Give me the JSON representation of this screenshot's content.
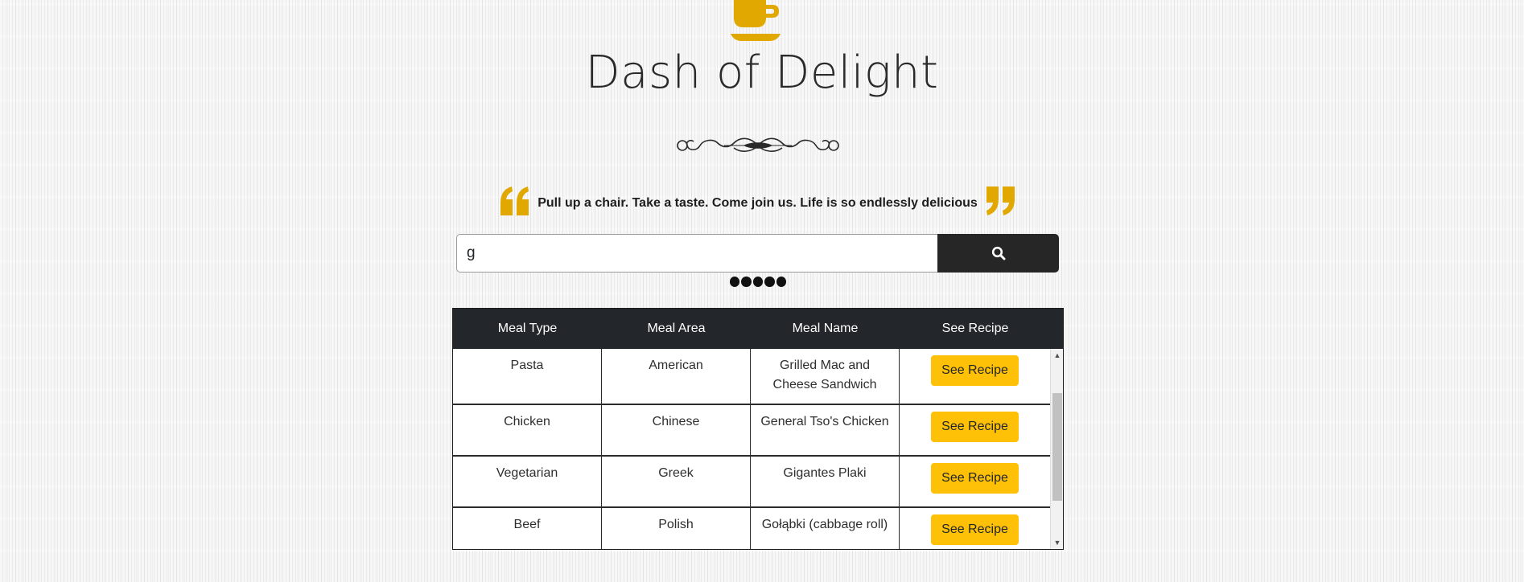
{
  "brand": {
    "title": "Dash of Delight",
    "accent_color": "#e0a800",
    "logo_icon": "coffee-cup-icon"
  },
  "tagline": "Pull up a chair. Take a taste. Come join us. Life is so endlessly delicious",
  "search": {
    "value": "g",
    "button_icon": "search-icon"
  },
  "table": {
    "headers": [
      "Meal Type",
      "Meal Area",
      "Meal Name",
      "See Recipe"
    ],
    "rows": [
      {
        "type": "Pasta",
        "area": "American",
        "name": "Grilled Mac and Cheese Sandwich",
        "action": "See Recipe"
      },
      {
        "type": "Chicken",
        "area": "Chinese",
        "name": "General Tso's Chicken",
        "action": "See Recipe"
      },
      {
        "type": "Vegetarian",
        "area": "Greek",
        "name": "Gigantes Plaki",
        "action": "See Recipe"
      },
      {
        "type": "Beef",
        "area": "Polish",
        "name": "Gołąbki (cabbage roll)",
        "action": "See Recipe"
      }
    ]
  }
}
